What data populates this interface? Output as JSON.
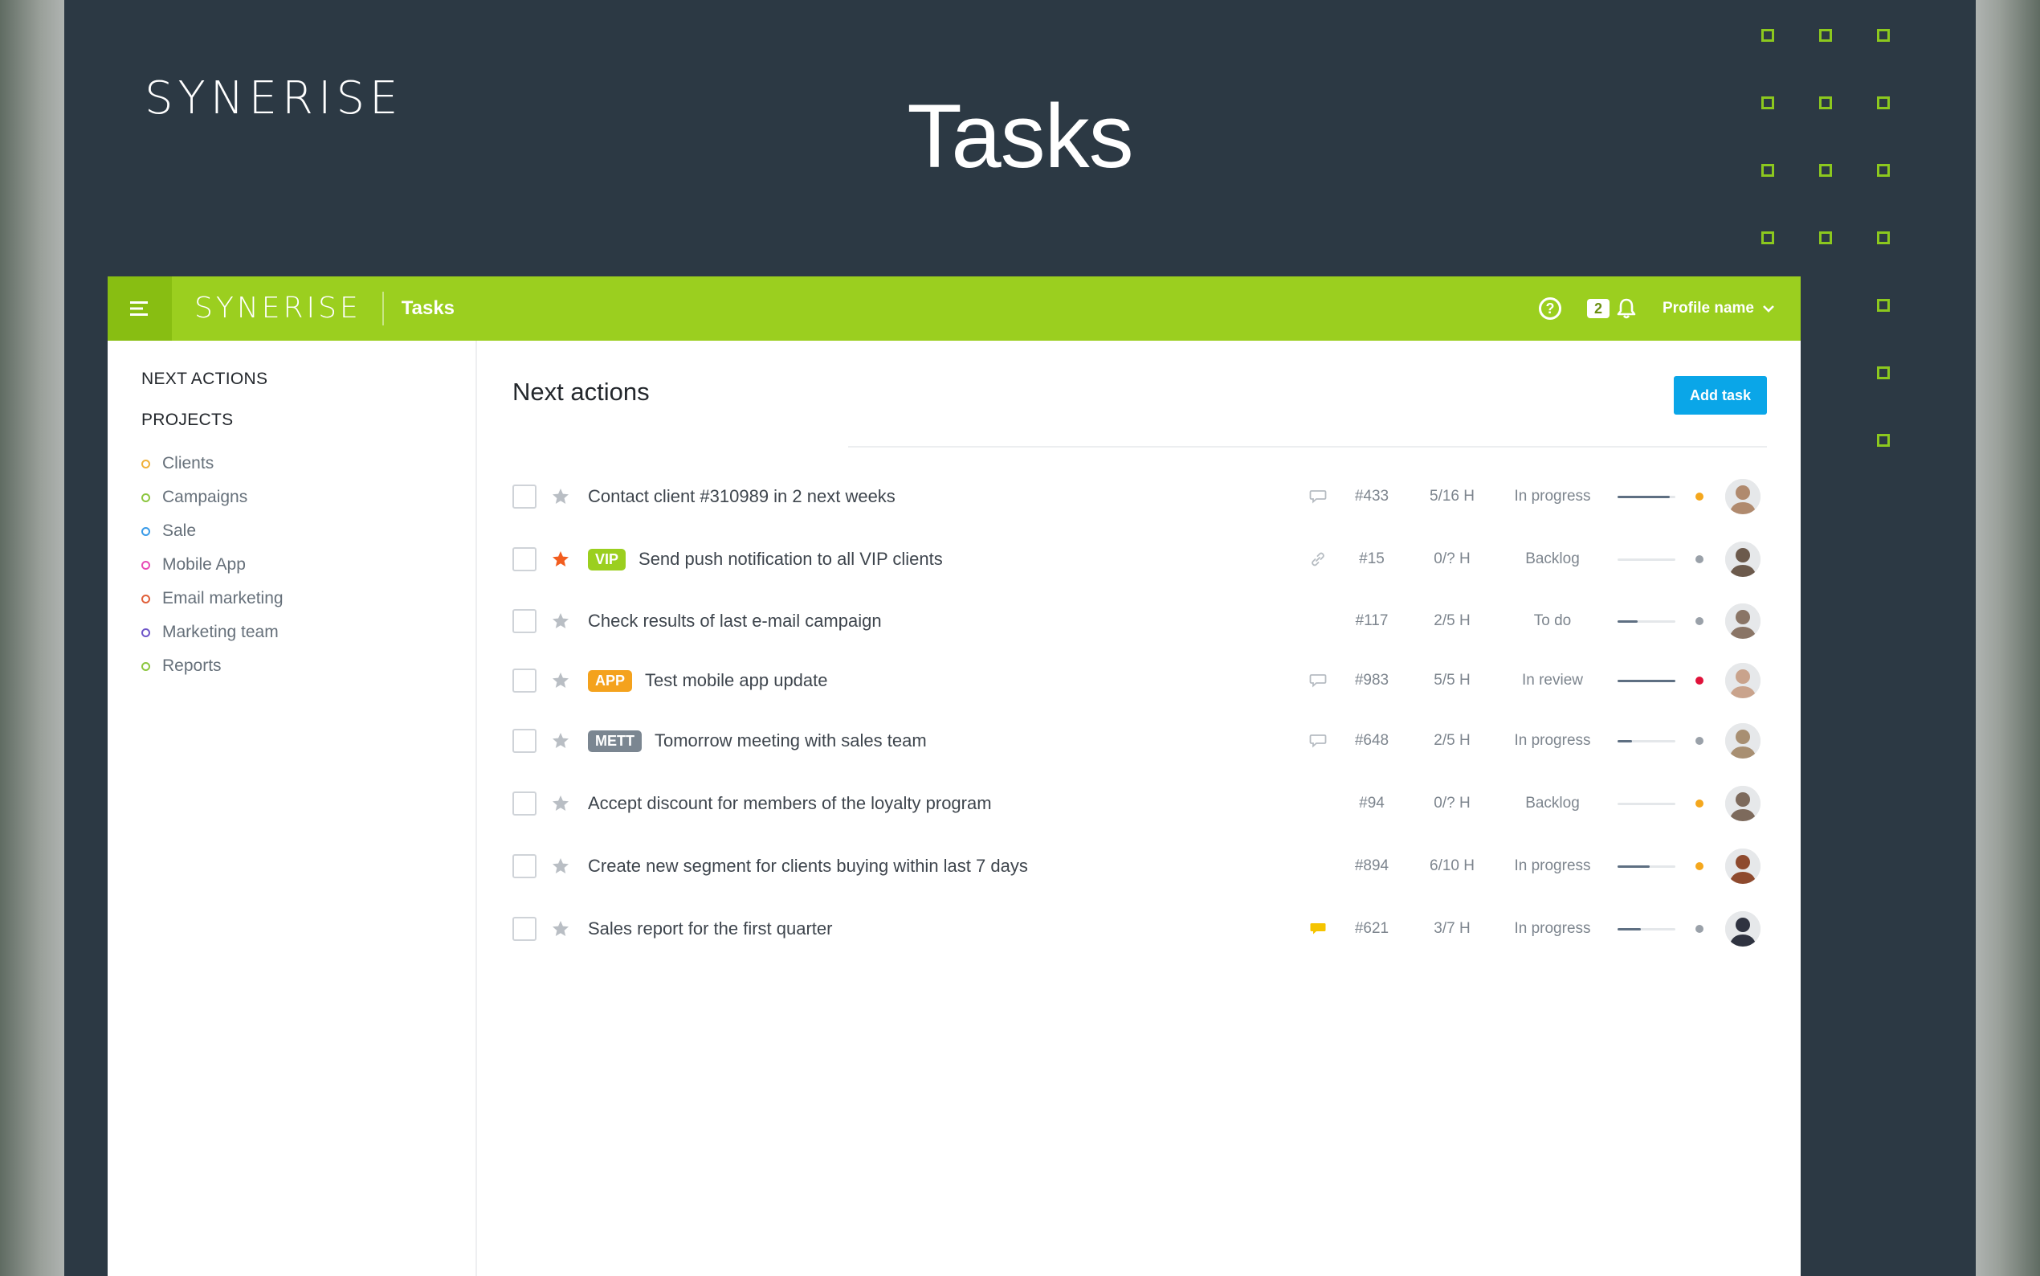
{
  "hero": {
    "logo": "SYNERISE",
    "title": "Tasks"
  },
  "topbar": {
    "logo": "SYNERISE",
    "title": "Tasks",
    "notifications_count": "2",
    "profile_name": "Profile name"
  },
  "sidebar": {
    "next_actions": "NEXT ACTIONS",
    "projects_heading": "PROJECTS",
    "projects": [
      {
        "label": "Clients",
        "color": "#f0b13a"
      },
      {
        "label": "Campaigns",
        "color": "#8cc63f"
      },
      {
        "label": "Sale",
        "color": "#3a9be8"
      },
      {
        "label": "Mobile App",
        "color": "#e84bb6"
      },
      {
        "label": "Email marketing",
        "color": "#e0603a"
      },
      {
        "label": "Marketing team",
        "color": "#6e55c8"
      },
      {
        "label": "Reports",
        "color": "#8cc63f"
      }
    ]
  },
  "main": {
    "title": "Next actions",
    "add_task": "Add task",
    "tasks": [
      {
        "title": "Contact client #310989 in 2 next weeks",
        "tag": "",
        "tag_color": "",
        "starred": false,
        "meta_icon": "comment-icon",
        "id": "#433",
        "hours": "5/16 H",
        "status": "In progress",
        "progress": 0.9,
        "priority_color": "#f4a71d",
        "avatar_bg": "#b08a6e"
      },
      {
        "title": "Send push notification to all VIP clients",
        "tag": "VIP",
        "tag_color": "#9bcf1f",
        "starred": true,
        "meta_icon": "link-icon",
        "id": "#15",
        "hours": "0/? H",
        "status": "Backlog",
        "progress": 0,
        "priority_color": "#9aa1a9",
        "avatar_bg": "#6c5a4c"
      },
      {
        "title": "Check results of last e-mail campaign",
        "tag": "",
        "tag_color": "",
        "starred": false,
        "meta_icon": "",
        "id": "#117",
        "hours": "2/5 H",
        "status": "To do",
        "progress": 0.35,
        "priority_color": "#9aa1a9",
        "avatar_bg": "#8a7566"
      },
      {
        "title": "Test mobile app update",
        "tag": "APP",
        "tag_color": "#f4a21d",
        "starred": false,
        "meta_icon": "comment-icon",
        "id": "#983",
        "hours": "5/5 H",
        "status": "In review",
        "progress": 1,
        "priority_color": "#e0123a",
        "avatar_bg": "#c9a38c"
      },
      {
        "title": "Tomorrow meeting with sales team",
        "tag": "METT",
        "tag_color": "#7b8691",
        "starred": false,
        "meta_icon": "comment-icon",
        "id": "#648",
        "hours": "2/5 H",
        "status": "In progress",
        "progress": 0.25,
        "priority_color": "#9aa1a9",
        "avatar_bg": "#a88f72"
      },
      {
        "title": "Accept discount for members of the loyalty program",
        "tag": "",
        "tag_color": "",
        "starred": false,
        "meta_icon": "",
        "id": "#94",
        "hours": "0/? H",
        "status": "Backlog",
        "progress": 0,
        "priority_color": "#f4a71d",
        "avatar_bg": "#7d6a5c"
      },
      {
        "title": "Create new segment for clients buying within last 7 days",
        "tag": "",
        "tag_color": "",
        "starred": false,
        "meta_icon": "",
        "id": "#894",
        "hours": "6/10 H",
        "status": "In progress",
        "progress": 0.55,
        "priority_color": "#f4a71d",
        "avatar_bg": "#8e4a2e"
      },
      {
        "title": "Sales report for the first quarter",
        "tag": "",
        "tag_color": "",
        "starred": false,
        "meta_icon": "comment-filled-icon",
        "id": "#621",
        "hours": "3/7 H",
        "status": "In progress",
        "progress": 0.4,
        "priority_color": "#9aa1a9",
        "avatar_bg": "#2f3340"
      }
    ]
  },
  "colors": {
    "brand_green": "#9bcf1f",
    "accent_blue": "#0aa6e8",
    "dark_bg": "#2c3944"
  }
}
